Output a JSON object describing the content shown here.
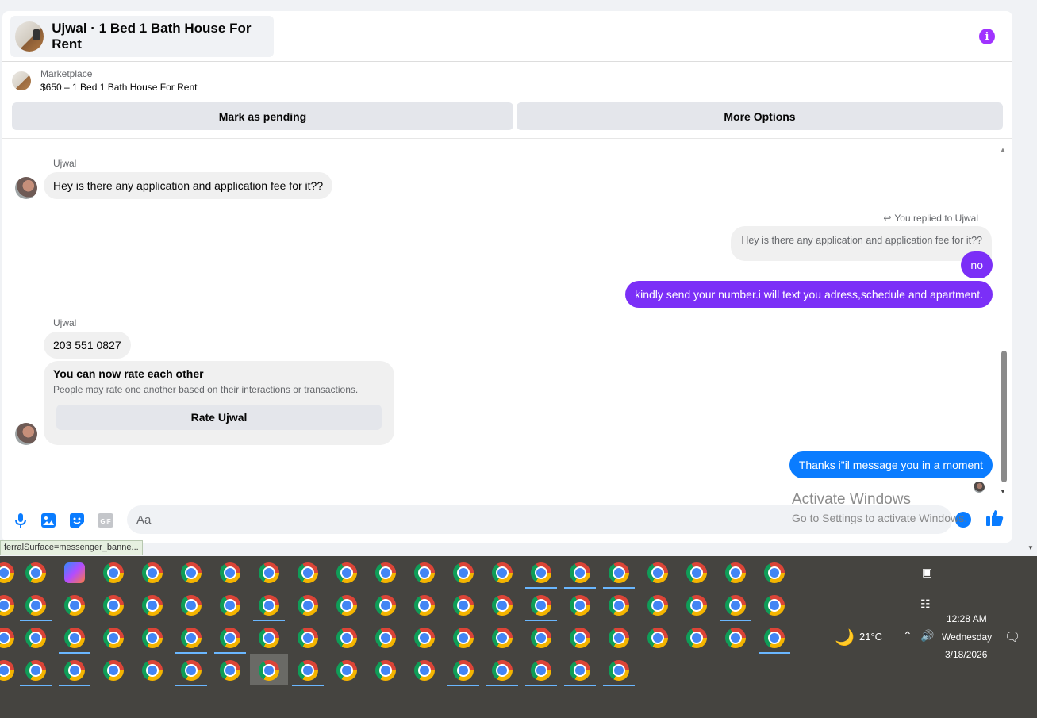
{
  "conversation": {
    "title": "Ujwal · 1 Bed 1 Bath House For Rent",
    "marketplace_label": "Marketplace",
    "listing": "$650 – 1 Bed 1 Bath House For Rent",
    "actions": {
      "pending": "Mark as pending",
      "more": "More Options"
    }
  },
  "messages": {
    "sender_name": "Ujwal",
    "msg1": "Hey is there any application and application fee for it??",
    "reply_note": "You replied to Ujwal",
    "quoted": "Hey is there any application and application fee for it??",
    "reply_no": "no",
    "reply_number": "kindly send your number.i will text you adress,schedule and apartment.",
    "sender_name_2": "Ujwal",
    "phone": "203 551 0827",
    "rate_title": "You can now rate each other",
    "rate_sub": "People may rate one another based on their interactions or transactions.",
    "rate_button": "Rate Ujwal",
    "last_reply": "Thanks i\"il message you in a moment"
  },
  "composer": {
    "placeholder": "Aa",
    "icons": [
      "microphone-icon",
      "photo-icon",
      "sticker-icon",
      "gif-icon",
      "emoji-icon",
      "thumbs-up-icon"
    ],
    "gif_label": "GIF"
  },
  "watermark": {
    "line1": "Activate Windows",
    "line2": "Go to Settings to activate Windows."
  },
  "status_url": "ferralSurface=messenger_banne...",
  "taskbar": {
    "temperature": "21°C",
    "time": "12:28 AM",
    "day": "Wednesday",
    "date": "3/18/2026"
  },
  "colors": {
    "accent_purple": "#7b2ff7",
    "accent_blue": "#0a7cff",
    "info_purple": "#a033ff"
  }
}
